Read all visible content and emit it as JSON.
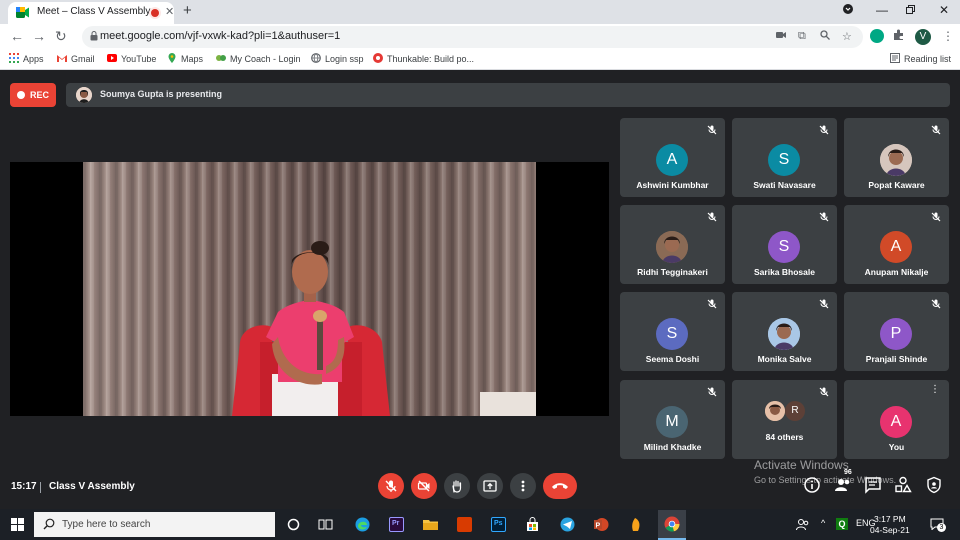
{
  "browser": {
    "tab_title": "Meet – Class V Assembly",
    "new_tab_symbol": "+",
    "url": "meet.google.com/vjf-vxwk-kad?pli=1&authuser=1",
    "profile_initial": "V",
    "window_controls": [
      "chevron-down-icon",
      "minimize-icon",
      "restore-icon",
      "close-icon"
    ]
  },
  "bookmarks": {
    "items": [
      {
        "label": "Apps",
        "icon": "apps-grid-icon"
      },
      {
        "label": "Gmail",
        "icon": "gmail-icon"
      },
      {
        "label": "YouTube",
        "icon": "youtube-icon"
      },
      {
        "label": "Maps",
        "icon": "maps-icon"
      },
      {
        "label": "My Coach - Login",
        "icon": "coach-icon"
      },
      {
        "label": "Login ssp",
        "icon": "globe-icon"
      },
      {
        "label": "Thunkable: Build po...",
        "icon": "thunkable-icon"
      }
    ],
    "reading_list": "Reading list"
  },
  "meet": {
    "rec_label": "REC",
    "presenting_text": "Soumya Gupta is presenting",
    "time": "15:17",
    "meeting_title": "Class V Assembly",
    "people_count": "96",
    "participants": [
      {
        "name": "Ashwini Kumbhar",
        "initial": "A",
        "color": "#0b8ba3",
        "photo": false
      },
      {
        "name": "Swati Navasare",
        "initial": "S",
        "color": "#0b8ba3",
        "photo": false
      },
      {
        "name": "Popat Kaware",
        "initial": "",
        "color": "#d6c6bd",
        "photo": true
      },
      {
        "name": "Ridhi Tegginakeri",
        "initial": "",
        "color": "#8a6a55",
        "photo": true
      },
      {
        "name": "Sarika Bhosale",
        "initial": "S",
        "color": "#8e57c8",
        "photo": false
      },
      {
        "name": "Anupam Nikalje",
        "initial": "A",
        "color": "#d14a28",
        "photo": false
      },
      {
        "name": "Seema Doshi",
        "initial": "S",
        "color": "#5c6bc0",
        "photo": false
      },
      {
        "name": "Monika Salve",
        "initial": "",
        "color": "#a9c7e6",
        "photo": true
      },
      {
        "name": "Pranjali Shinde",
        "initial": "P",
        "color": "#8e57c8",
        "photo": false
      },
      {
        "name": "Milind Khadke",
        "initial": "M",
        "color": "#4a6572",
        "photo": false
      },
      {
        "name": "84 others",
        "initial": "R",
        "color": "#5d4037",
        "photo": false
      },
      {
        "name": "You",
        "initial": "A",
        "color": "#e8336f",
        "photo": false
      }
    ],
    "watermark": {
      "line1": "Activate Windows",
      "line2": "Go to Settings to activate Windows."
    }
  },
  "taskbar": {
    "search_placeholder": "Type here to search",
    "language": "ENG",
    "time": "3:17 PM",
    "date": "04-Sep-21",
    "notification_count": "3"
  }
}
